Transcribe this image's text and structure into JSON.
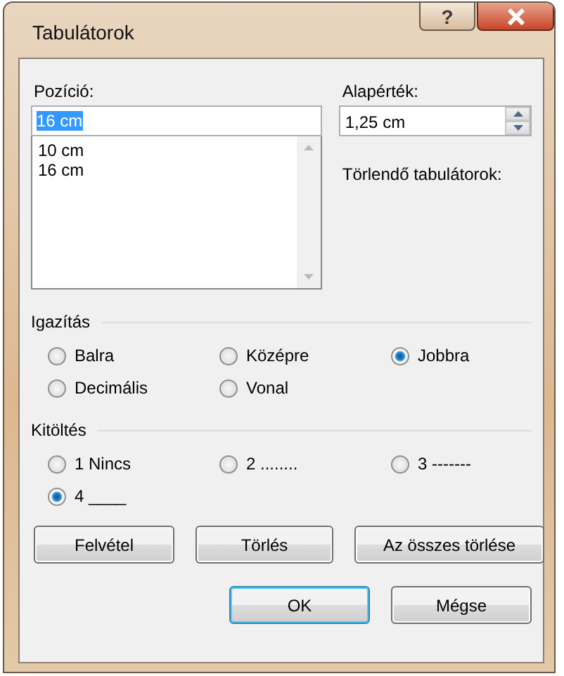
{
  "window": {
    "title": "Tabulátorok",
    "help_button": "?"
  },
  "position": {
    "label": "Pozíció:",
    "value": "16 cm",
    "list": [
      "10 cm",
      "16 cm"
    ]
  },
  "default_step": {
    "label": "Alapérték:",
    "value": "1,25 cm"
  },
  "to_clear": {
    "label": "Törlendő tabulátorok:"
  },
  "alignment": {
    "title": "Igazítás",
    "options": [
      {
        "label": "Balra",
        "selected": false
      },
      {
        "label": "Középre",
        "selected": false
      },
      {
        "label": "Jobbra",
        "selected": true
      },
      {
        "label": "Decimális",
        "selected": false
      },
      {
        "label": "Vonal",
        "selected": false
      }
    ]
  },
  "leader": {
    "title": "Kitöltés",
    "options": [
      {
        "label": "1 Nincs",
        "selected": false
      },
      {
        "label": "2 ........",
        "selected": false
      },
      {
        "label": "3 -------",
        "selected": false
      },
      {
        "label": "4 ____",
        "selected": true
      }
    ]
  },
  "action_buttons": [
    "Felvétel",
    "Törlés",
    "Az összes törlése"
  ],
  "dialog_buttons": [
    {
      "label": "OK",
      "default": true
    },
    {
      "label": "Mégse",
      "default": false
    }
  ]
}
